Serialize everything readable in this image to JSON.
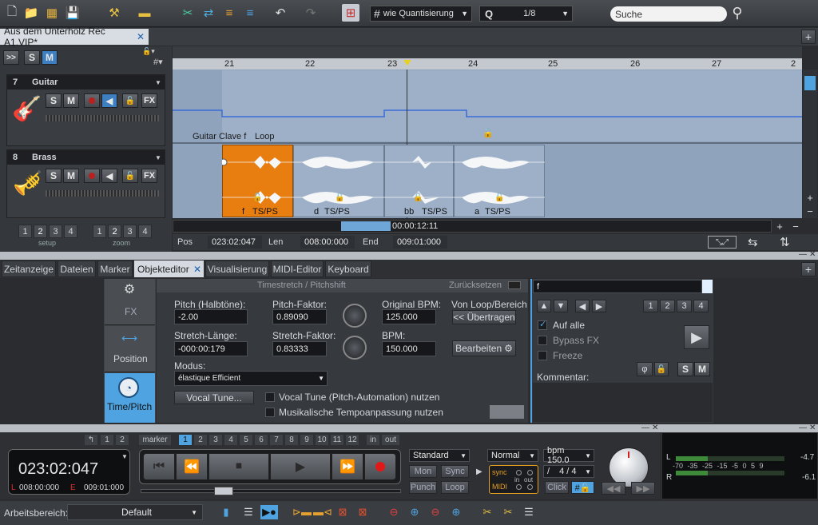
{
  "toolbar": {
    "quantize": "wie Quantisierung",
    "q_label": "Q",
    "q_value": "1/8",
    "search_placeholder": "Suche"
  },
  "project_tab": "Aus dem Unterholz Rec A1.VIP*",
  "timeline": {
    "marks": [
      "21",
      "22",
      "23",
      "24",
      "25",
      "26",
      "27",
      "2"
    ]
  },
  "tracks": [
    {
      "num": "7",
      "name": "Guitar"
    },
    {
      "num": "8",
      "name": "Brass"
    }
  ],
  "track_btn": {
    "s": "S",
    "m": "M",
    "fx": "FX"
  },
  "head_btns": {
    "expand": ">>",
    "s": "S",
    "m": "M"
  },
  "clips": {
    "guitar_label": "Guitar Clave f",
    "guitar_loop": "Loop",
    "brass": [
      {
        "key": "f",
        "fx": "TS/PS"
      },
      {
        "key": "d",
        "fx": "TS/PS"
      },
      {
        "key": "bb",
        "fx": "TS/PS"
      },
      {
        "key": "a",
        "fx": "TS/PS"
      }
    ]
  },
  "zoom": {
    "setup_label": "setup",
    "zoom_label": "zoom",
    "nums": [
      "1",
      "2",
      "3",
      "4"
    ]
  },
  "position": {
    "pos_label": "Pos",
    "pos": "023:02:047",
    "len_label": "Len",
    "len": "008:00:000",
    "end_label": "End",
    "end": "009:01:000",
    "scroll_time": "00:00:12:11"
  },
  "tabs": [
    "Zeitanzeige",
    "Dateien",
    "Marker",
    "Objekteditor",
    "Visualisierung",
    "MIDI-Editor",
    "Keyboard"
  ],
  "side": {
    "fx": "FX",
    "position": "Position",
    "timepitch": "Time/Pitch"
  },
  "editor": {
    "header": "Timestretch / Pitchshift",
    "reset": "Zurücksetzen",
    "pitch_label": "Pitch (Halbtöne):",
    "pitch": "-2.00",
    "pitch_factor_label": "Pitch-Faktor:",
    "pitch_factor": "0.89090",
    "orig_bpm_label": "Original BPM:",
    "orig_bpm": "125.000",
    "loop_label": "Von Loop/Bereich",
    "transfer_btn": "<< Übertragen",
    "stretch_len_label": "Stretch-Länge:",
    "stretch_len": "-000:00:179",
    "stretch_factor_label": "Stretch-Faktor:",
    "stretch_factor": "0.83333",
    "bpm_label": "BPM:",
    "bpm": "150.000",
    "edit_btn": "Bearbeiten",
    "mode_label": "Modus:",
    "mode": "élastique Efficient",
    "vocal_btn": "Vocal Tune...",
    "vocal_chk": "Vocal Tune (Pitch-Automation) nutzen",
    "tempo_chk": "Musikalische Tempoanpassung nutzen"
  },
  "right_panel": {
    "name": "f",
    "nums": [
      "1",
      "2",
      "3",
      "4"
    ],
    "all": "Auf alle",
    "bypass": "Bypass FX",
    "freeze": "Freeze",
    "comment": "Kommentar:",
    "s": "S",
    "m": "M"
  },
  "transport": {
    "nums": [
      "1",
      "2"
    ],
    "marker": "marker",
    "marker_nums": [
      "1",
      "2",
      "3",
      "4",
      "5",
      "6",
      "7",
      "8",
      "9",
      "10",
      "11",
      "12"
    ],
    "in": "in",
    "out": "out",
    "time": "023:02:047",
    "l": "L",
    "l_time": "008:00:000",
    "e": "E",
    "e_time": "009:01:000",
    "standard": "Standard",
    "mon": "Mon",
    "sync": "Sync",
    "punch": "Punch",
    "loop": "Loop",
    "normal": "Normal",
    "bpm": "bpm 150.0",
    "sig_slash": "/",
    "sig": "4 / 4",
    "click": "Click",
    "sync_small": "sync",
    "midi_small": "MIDI",
    "in_small": "in",
    "out_small": "out"
  },
  "meter": {
    "l": "L",
    "r": "R",
    "scale": "-70 -35 -25 -15 -5 0 5 9",
    "l_val": "-4.7",
    "r_val": "-6.1"
  },
  "status": {
    "label": "Arbeitsbereich:",
    "value": "Default"
  },
  "colors": {
    "accent": "#4fa3e0",
    "clip_orange": "#e87d10",
    "track_bg": "#8fa3bd"
  }
}
